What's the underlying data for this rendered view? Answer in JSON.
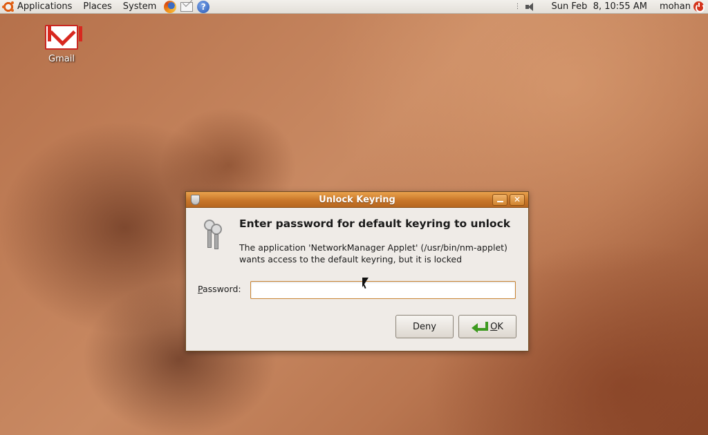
{
  "top_panel": {
    "menus": [
      "Applications",
      "Places",
      "System"
    ],
    "launchers": [
      "firefox-icon",
      "mail-icon",
      "help-icon"
    ],
    "help_glyph": "?",
    "clock": "Sun Feb  8, 10:55 AM",
    "user": "mohan"
  },
  "desktop": {
    "icons": [
      {
        "label": "Gmail",
        "icon": "gmail-icon"
      }
    ]
  },
  "dialog": {
    "title": "Unlock Keyring",
    "heading": "Enter password for default keyring to unlock",
    "message_line1": "The application 'NetworkManager Applet' (/usr/bin/nm-applet)",
    "message_line2": "wants access to the default keyring, but it is locked",
    "password_label_mnemonic": "P",
    "password_label_rest": "assword:",
    "password_value": "",
    "deny_label": "Deny",
    "ok_mnemonic": "O",
    "ok_rest": "K",
    "close_glyph": "✕"
  },
  "colors": {
    "titlebar": "#c9772a",
    "accent_orange": "#dd5a10",
    "ok_arrow": "#3d9a1f"
  }
}
